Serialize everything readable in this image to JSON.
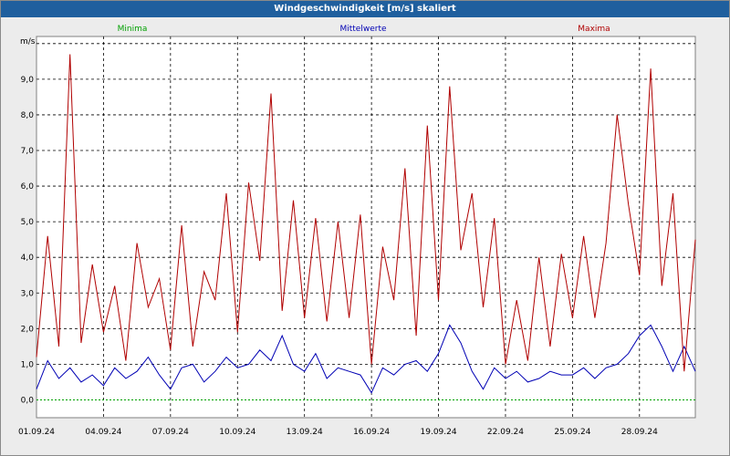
{
  "window": {
    "title": "Windgeschwindigkeit [m/s] skaliert"
  },
  "legend": {
    "min_label": "Minima",
    "mean_label": "Mittelwerte",
    "max_label": "Maxima"
  },
  "colors": {
    "titlebar": "#1f5f9e",
    "min": "#00a000",
    "mean": "#0000b4",
    "max": "#b00000",
    "grid": "#000000",
    "plot_bg": "#ffffff"
  },
  "chart_data": {
    "type": "line",
    "title": "Windgeschwindigkeit [m/s] skaliert",
    "ylabel": "m/s",
    "xlabel": "",
    "ylim": [
      -0.5,
      10.2
    ],
    "xlim": [
      "2024-09-01",
      "2024-09-30 12:00"
    ],
    "y_ticks": [
      "0,0",
      "1,0",
      "2,0",
      "3,0",
      "4,0",
      "5,0",
      "6,0",
      "7,0",
      "8,0",
      "9,0"
    ],
    "x_ticks": [
      "01.09.24",
      "04.09.24",
      "07.09.24",
      "10.09.24",
      "13.09.24",
      "16.09.24",
      "19.09.24",
      "22.09.24",
      "25.09.24",
      "28.09.24"
    ],
    "grid": true,
    "legend_position": "top",
    "x": [
      "2024-09-01",
      "2024-09-01 12:00",
      "2024-09-02",
      "2024-09-02 12:00",
      "2024-09-03",
      "2024-09-03 12:00",
      "2024-09-04",
      "2024-09-04 12:00",
      "2024-09-05",
      "2024-09-05 12:00",
      "2024-09-06",
      "2024-09-06 12:00",
      "2024-09-07",
      "2024-09-07 12:00",
      "2024-09-08",
      "2024-09-08 12:00",
      "2024-09-09",
      "2024-09-09 12:00",
      "2024-09-10",
      "2024-09-10 12:00",
      "2024-09-11",
      "2024-09-11 12:00",
      "2024-09-12",
      "2024-09-12 12:00",
      "2024-09-13",
      "2024-09-13 12:00",
      "2024-09-14",
      "2024-09-14 12:00",
      "2024-09-15",
      "2024-09-15 12:00",
      "2024-09-16",
      "2024-09-16 12:00",
      "2024-09-17",
      "2024-09-17 12:00",
      "2024-09-18",
      "2024-09-18 12:00",
      "2024-09-19",
      "2024-09-19 12:00",
      "2024-09-20",
      "2024-09-20 12:00",
      "2024-09-21",
      "2024-09-21 12:00",
      "2024-09-22",
      "2024-09-22 12:00",
      "2024-09-23",
      "2024-09-23 12:00",
      "2024-09-24",
      "2024-09-24 12:00",
      "2024-09-25",
      "2024-09-25 12:00",
      "2024-09-26",
      "2024-09-26 12:00",
      "2024-09-27",
      "2024-09-27 12:00",
      "2024-09-28",
      "2024-09-28 12:00",
      "2024-09-29",
      "2024-09-29 12:00",
      "2024-09-30",
      "2024-09-30 12:00"
    ],
    "series": [
      {
        "name": "Minima",
        "values": [
          0.0,
          0.0,
          0.0,
          0.0,
          0.0,
          0.0,
          0.0,
          0.0,
          0.0,
          0.0,
          0.0,
          0.0,
          0.0,
          0.0,
          0.0,
          0.0,
          0.0,
          0.0,
          0.0,
          0.0,
          0.0,
          0.0,
          0.0,
          0.0,
          0.0,
          0.0,
          0.0,
          0.0,
          0.0,
          0.0,
          0.0,
          0.0,
          0.0,
          0.0,
          0.0,
          0.0,
          0.0,
          0.0,
          0.0,
          0.0,
          0.0,
          0.0,
          0.0,
          0.0,
          0.0,
          0.0,
          0.0,
          0.0,
          0.0,
          0.0,
          0.0,
          0.0,
          0.0,
          0.0,
          0.0,
          0.0,
          0.0,
          0.0,
          0.0,
          0.0
        ]
      },
      {
        "name": "Mittelwerte",
        "values": [
          0.3,
          1.1,
          0.6,
          0.9,
          0.5,
          0.7,
          0.4,
          0.9,
          0.6,
          0.8,
          1.2,
          0.7,
          0.3,
          0.9,
          1.0,
          0.5,
          0.8,
          1.2,
          0.9,
          1.0,
          1.4,
          1.1,
          1.8,
          1.0,
          0.8,
          1.3,
          0.6,
          0.9,
          0.8,
          0.7,
          0.2,
          0.9,
          0.7,
          1.0,
          1.1,
          0.8,
          1.3,
          2.1,
          1.6,
          0.8,
          0.3,
          0.9,
          0.6,
          0.8,
          0.5,
          0.6,
          0.8,
          0.7,
          0.7,
          0.9,
          0.6,
          0.9,
          1.0,
          1.3,
          1.8,
          2.1,
          1.5,
          0.8,
          1.5,
          0.8
        ]
      },
      {
        "name": "Maxima",
        "values": [
          1.2,
          4.6,
          1.5,
          9.7,
          1.6,
          3.8,
          1.9,
          3.2,
          1.1,
          4.4,
          2.6,
          3.4,
          1.4,
          4.9,
          1.5,
          3.6,
          2.8,
          5.8,
          1.9,
          6.1,
          3.9,
          8.6,
          2.5,
          5.6,
          2.3,
          5.1,
          2.2,
          5.0,
          2.3,
          5.2,
          1.0,
          4.3,
          2.8,
          6.5,
          1.8,
          7.7,
          2.8,
          8.8,
          4.2,
          5.8,
          2.6,
          5.1,
          1.0,
          2.8,
          1.1,
          4.0,
          1.5,
          4.1,
          2.3,
          4.6,
          2.3,
          4.4,
          8.0,
          5.5,
          3.5,
          9.3,
          3.2,
          5.8,
          0.8,
          4.5
        ]
      }
    ]
  }
}
